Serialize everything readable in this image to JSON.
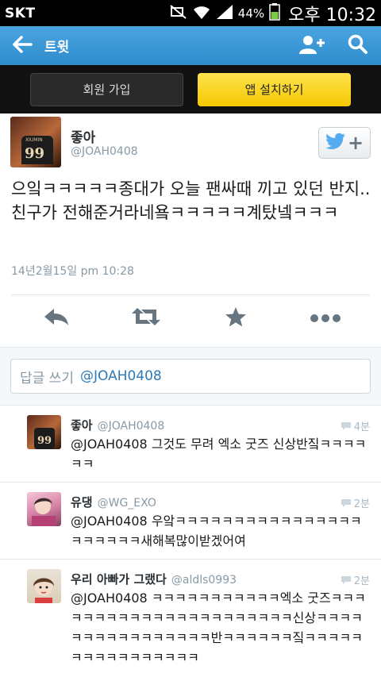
{
  "statusbar": {
    "carrier": "SKT",
    "battery": "44%",
    "time": "오후 10:32"
  },
  "navbar": {
    "title": "트윗"
  },
  "signupbar": {
    "signup_label": "회원 가입",
    "install_label": "앱 설치하기"
  },
  "tweet": {
    "name": "좋아",
    "handle": "@JOAH0408",
    "text": "으잌ㅋㅋㅋㅋㅋ종대가 오늘 팬싸때 끼고 있던 반지.. 친구가 전해준거라네욬ㅋㅋㅋㅋㅋ계탔넼ㅋㅋㅋ",
    "date": "14년2월15일 pm 10:28"
  },
  "reply_box": {
    "placeholder": "답글 쓰기",
    "mention": "@JOAH0408"
  },
  "replies": [
    {
      "name": "좋아",
      "handle": "@JOAH0408",
      "time": "4분",
      "text": "@JOAH0408 그것도 무려 엑소 굿즈 신상반짘ㅋㅋㅋㅋㅋㅋ"
    },
    {
      "name": "유댕",
      "handle": "@WG_EXO",
      "time": "2분",
      "text": "@JOAH0408 우앜ㅋㅋㅋㅋㅋㅋㅋㅋㅋㅋㅋㅋㅋㅋㅋㅋㅋㅋㅋㅋㅋㅋ새해복많이받겠어여"
    },
    {
      "name": "우리 아빠가 그랬다",
      "handle": "@aldls0993",
      "time": "2분",
      "text": "@JOAH0408 ㅋㅋㅋㅋㅋㅋㅋㅋㅋㅋㅋ엑소 굿즈ㅋㅋㅋㅋㅋㅋㅋㅋㅋㅋㅋㅋㅋㅋㅋㅋㅋㅋㅋㅋㅋㅋ신상ㅋㅋㅋㅋㅋㅋㅋㅋㅋㅋㅋㅋㅋㅋㅋㅋ반ㅋㅋㅋㅋㅋㅋ짘ㅋㅋㅋㅋㅋㅋㅋㅋㅋㅋㅋㅋㅋㅋㅋㅋ"
    }
  ],
  "colors": {
    "nav_blue": "#3d9ad6",
    "install_yellow": "#ffd72b",
    "link_blue": "#2b7bb9"
  },
  "icons": [
    "back-arrow-icon",
    "add-user-icon",
    "search-icon",
    "twitter-bird-icon",
    "reply-icon",
    "retweet-icon",
    "favorite-star-icon",
    "more-dots-icon",
    "speech-bubble-icon"
  ]
}
